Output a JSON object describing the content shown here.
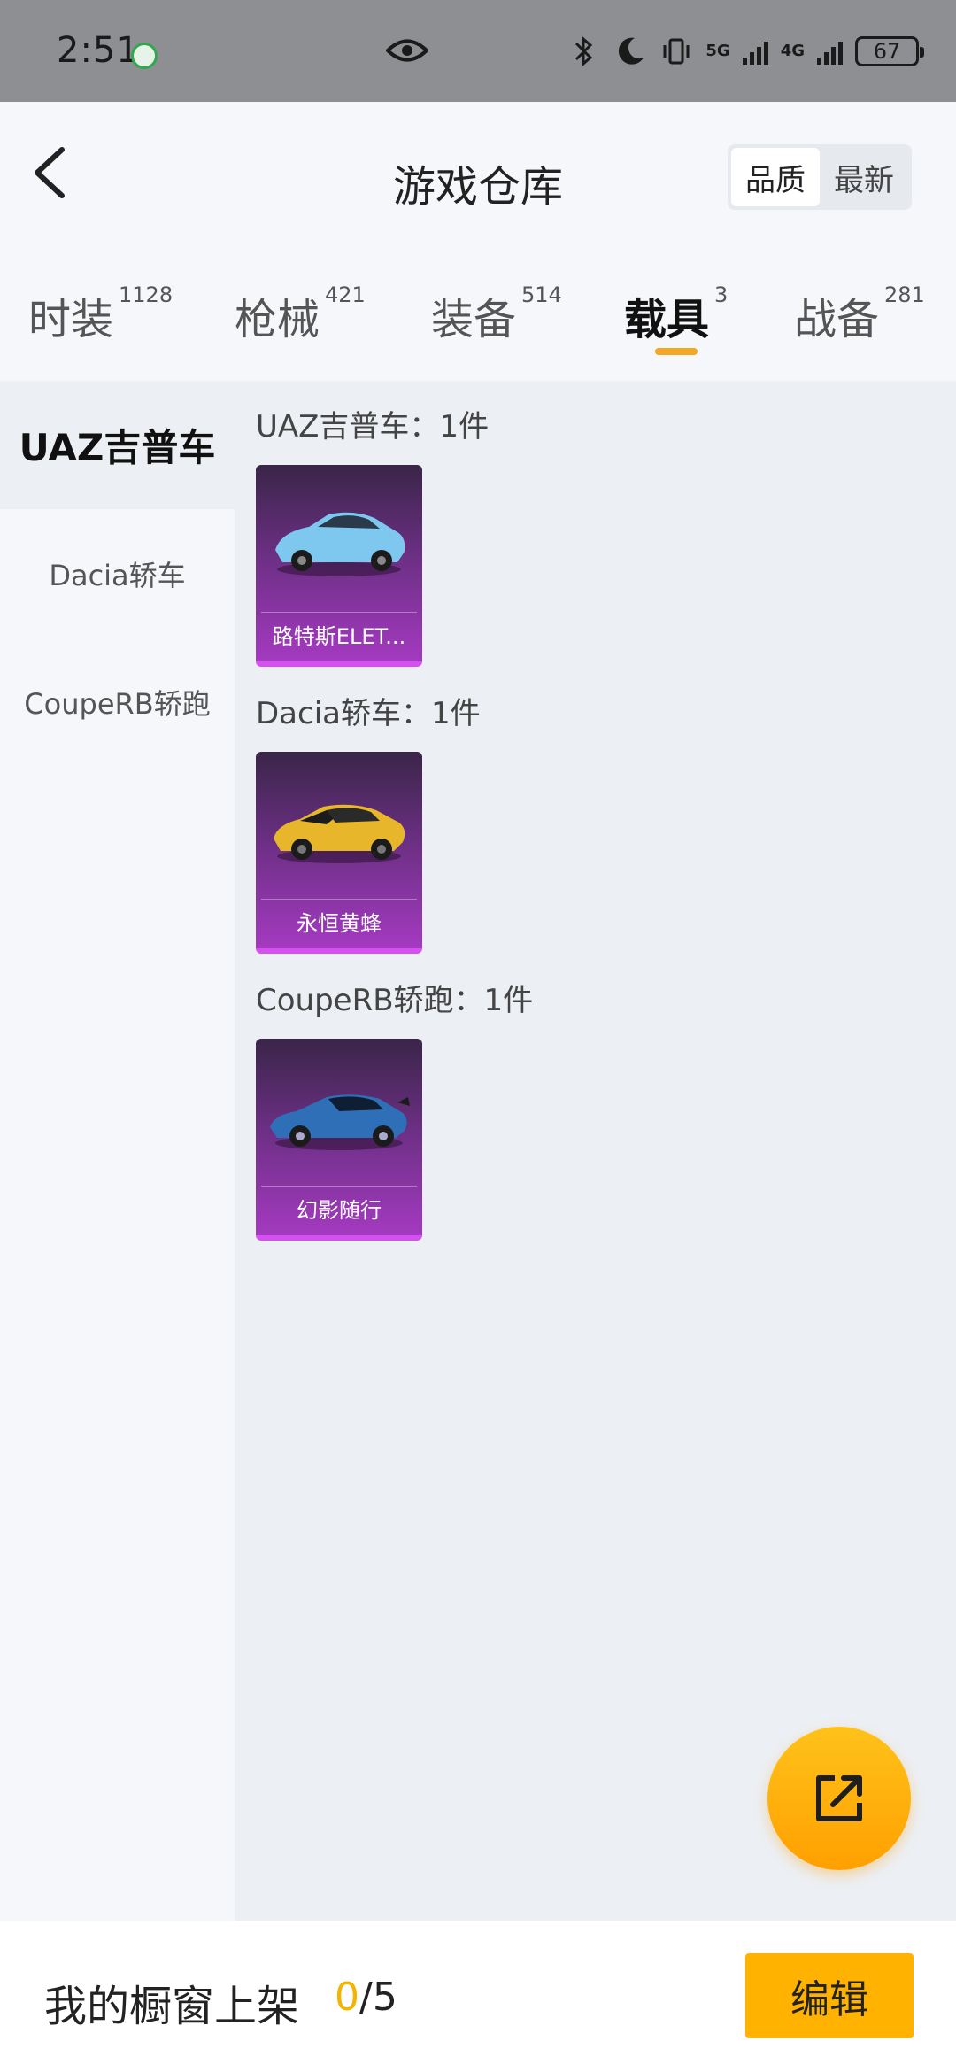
{
  "status_bar": {
    "time": "2:51",
    "network_1": "5G",
    "network_2": "4G",
    "battery": "67"
  },
  "header": {
    "title": "游戏仓库",
    "sort_options": [
      "品质",
      "最新"
    ],
    "sort_selected": "品质"
  },
  "tabs": [
    {
      "label": "时装",
      "count": "1128"
    },
    {
      "label": "枪械",
      "count": "421"
    },
    {
      "label": "装备",
      "count": "514"
    },
    {
      "label": "载具",
      "count": "3",
      "active": true
    },
    {
      "label": "战备",
      "count": "281"
    }
  ],
  "sidebar": {
    "items": [
      {
        "label": "UAZ吉普车",
        "active": true
      },
      {
        "label": "Dacia轿车"
      },
      {
        "label": "CoupeRB轿跑"
      }
    ]
  },
  "groups": [
    {
      "label": "UAZ吉普车：1件",
      "items": [
        {
          "name": "路特斯ELET...",
          "car_color": "#7ec8ef"
        }
      ]
    },
    {
      "label": "Dacia轿车：1件",
      "items": [
        {
          "name": "永恒黄蜂",
          "car_color": "#e7b62a"
        }
      ]
    },
    {
      "label": "CoupeRB轿跑：1件",
      "items": [
        {
          "name": "幻影随行",
          "car_color": "#2f6fb8"
        }
      ]
    }
  ],
  "bottom_bar": {
    "label": "我的橱窗上架",
    "count_current": "0",
    "count_total": "/5",
    "edit_label": "编辑"
  },
  "colors": {
    "accent": "#ffb300",
    "card_purple": "#a43ac0"
  }
}
